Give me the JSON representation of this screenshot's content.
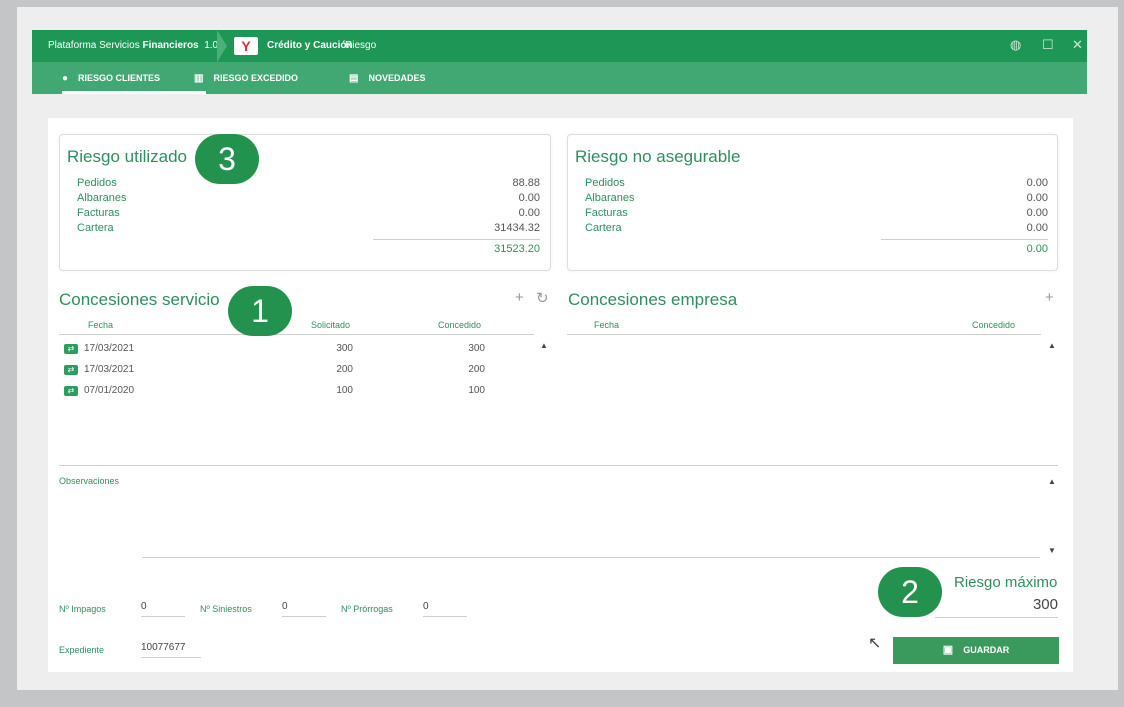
{
  "titlebar": {
    "app_prefix": "Plataforma Servicios ",
    "app_bold": "Financieros",
    "version": "1.0",
    "module": "Crédito y Caución",
    "section": "Riesgo",
    "logo_glyph": "Y",
    "icons": {
      "globe": "globe-icon",
      "maximize": "maximize-icon",
      "close": "close-icon"
    }
  },
  "tabs": [
    {
      "label": "RIESGO CLIENTES",
      "icon": "user-icon",
      "active": true
    },
    {
      "label": "RIESGO EXCEDIDO",
      "icon": "bar-chart-icon",
      "active": false
    },
    {
      "label": "NOVEDADES",
      "icon": "document-icon",
      "active": false
    }
  ],
  "riesgo_utilizado": {
    "title": "Riesgo utilizado",
    "rows": [
      {
        "label": "Pedidos",
        "value": "88.88"
      },
      {
        "label": "Albaranes",
        "value": "0.00"
      },
      {
        "label": "Facturas",
        "value": "0.00"
      },
      {
        "label": "Cartera",
        "value": "31434.32"
      }
    ],
    "total": "31523.20"
  },
  "riesgo_no_asegurable": {
    "title": "Riesgo no asegurable",
    "rows": [
      {
        "label": "Pedidos",
        "value": "0.00"
      },
      {
        "label": "Albaranes",
        "value": "0.00"
      },
      {
        "label": "Facturas",
        "value": "0.00"
      },
      {
        "label": "Cartera",
        "value": "0.00"
      }
    ],
    "total": "0.00"
  },
  "concesiones_servicio": {
    "title": "Concesiones servicio",
    "columns": {
      "fecha": "Fecha",
      "solicitado": "Solicitado",
      "concedido": "Concedido"
    },
    "rows": [
      {
        "fecha": "17/03/2021",
        "solicitado": "300",
        "concedido": "300"
      },
      {
        "fecha": "17/03/2021",
        "solicitado": "200",
        "concedido": "200"
      },
      {
        "fecha": "07/01/2020",
        "solicitado": "100",
        "concedido": "100"
      }
    ],
    "add_icon": "+",
    "refresh_icon": "↻"
  },
  "concesiones_empresa": {
    "title": "Concesiones empresa",
    "columns": {
      "fecha": "Fecha",
      "concedido": "Concedido"
    },
    "add_icon": "+"
  },
  "observaciones": {
    "label": "Observaciones"
  },
  "riesgo_maximo": {
    "label": "Riesgo máximo",
    "value": "300"
  },
  "counters": {
    "impagos_label": "Nº Impagos",
    "impagos_value": "0",
    "siniestros_label": "Nº Siniestros",
    "siniestros_value": "0",
    "prorrogas_label": "Nº Prórrogas",
    "prorrogas_value": "0"
  },
  "expediente": {
    "label": "Expediente",
    "value": "10077677"
  },
  "save_button": {
    "label": "GUARDAR",
    "icon": "floppy-icon"
  },
  "badges": {
    "one": "1",
    "two": "2",
    "three": "3"
  },
  "colors": {
    "brand_green": "#1e9656",
    "tab_green": "#42a873",
    "badge_green": "#24924f",
    "text_green": "#2f8f5c"
  }
}
